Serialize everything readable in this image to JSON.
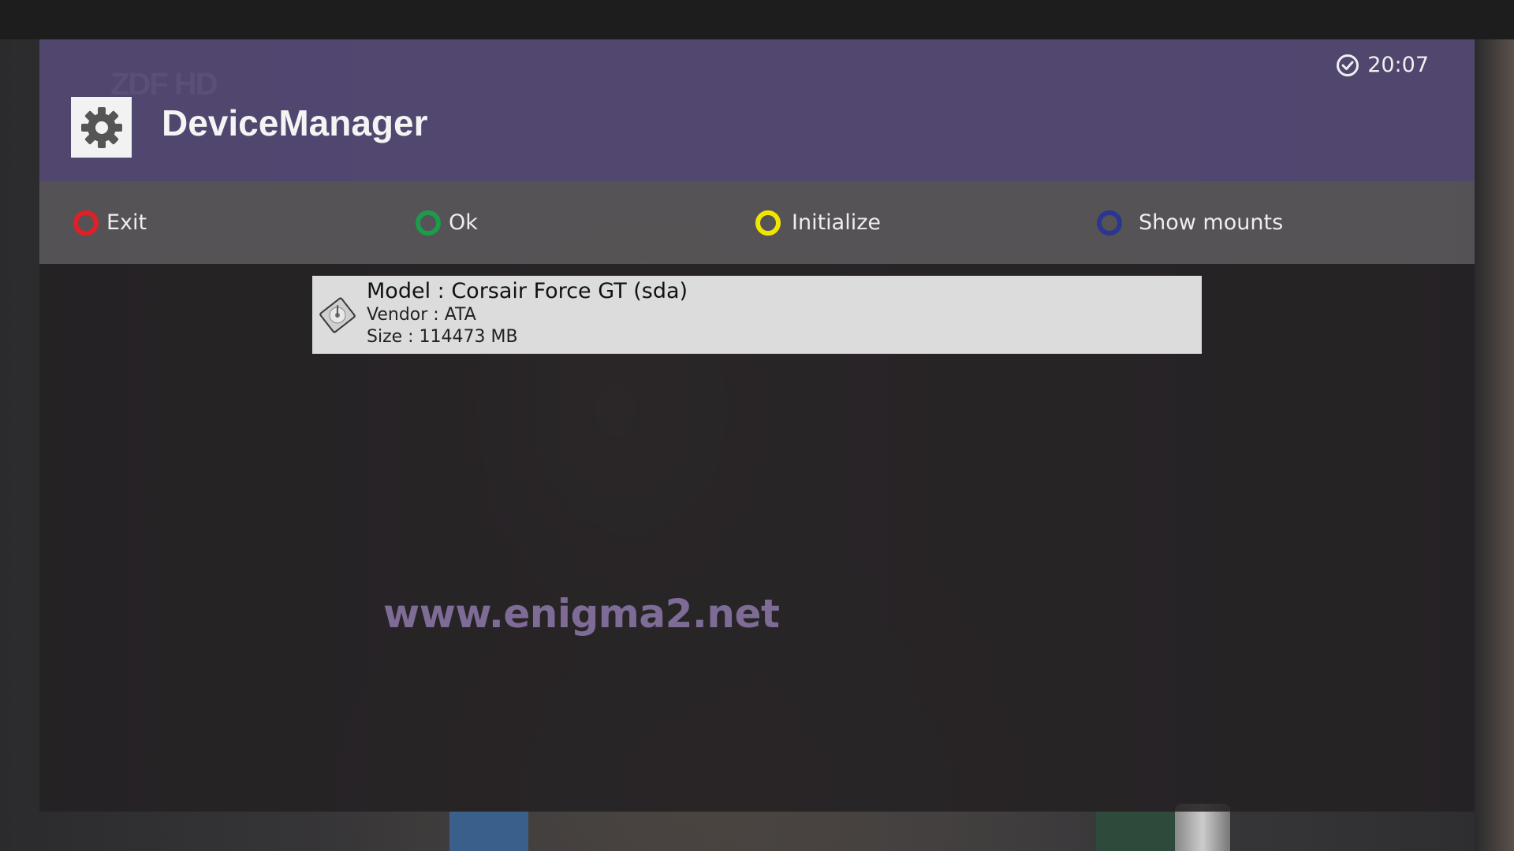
{
  "header": {
    "title": "DeviceManager",
    "logo_text": "ZDF HD",
    "clock_time": "20:07"
  },
  "buttons": [
    {
      "label": "Exit",
      "color": "#e02027",
      "icon": "red-circle-icon"
    },
    {
      "label": "Ok",
      "color": "#1d9a4b",
      "icon": "green-circle-icon"
    },
    {
      "label": "Initialize",
      "color": "#f2e600",
      "icon": "yellow-circle-icon"
    },
    {
      "label": "Show mounts",
      "color": "#2b3690",
      "icon": "blue-circle-icon"
    }
  ],
  "devices": [
    {
      "icon": "hard-disk-icon",
      "model": "Model : Corsair Force GT (sda)",
      "vendor": "Vendor : ATA",
      "size": "Size : 114473 MB"
    }
  ],
  "watermark": "www.enigma2.net",
  "colors": {
    "header_bg": "#534873",
    "buttonbar_bg": "#565456",
    "content_bg": "#242123",
    "selection_bg": "#dcdcdc",
    "watermark": "#7e6c96"
  }
}
